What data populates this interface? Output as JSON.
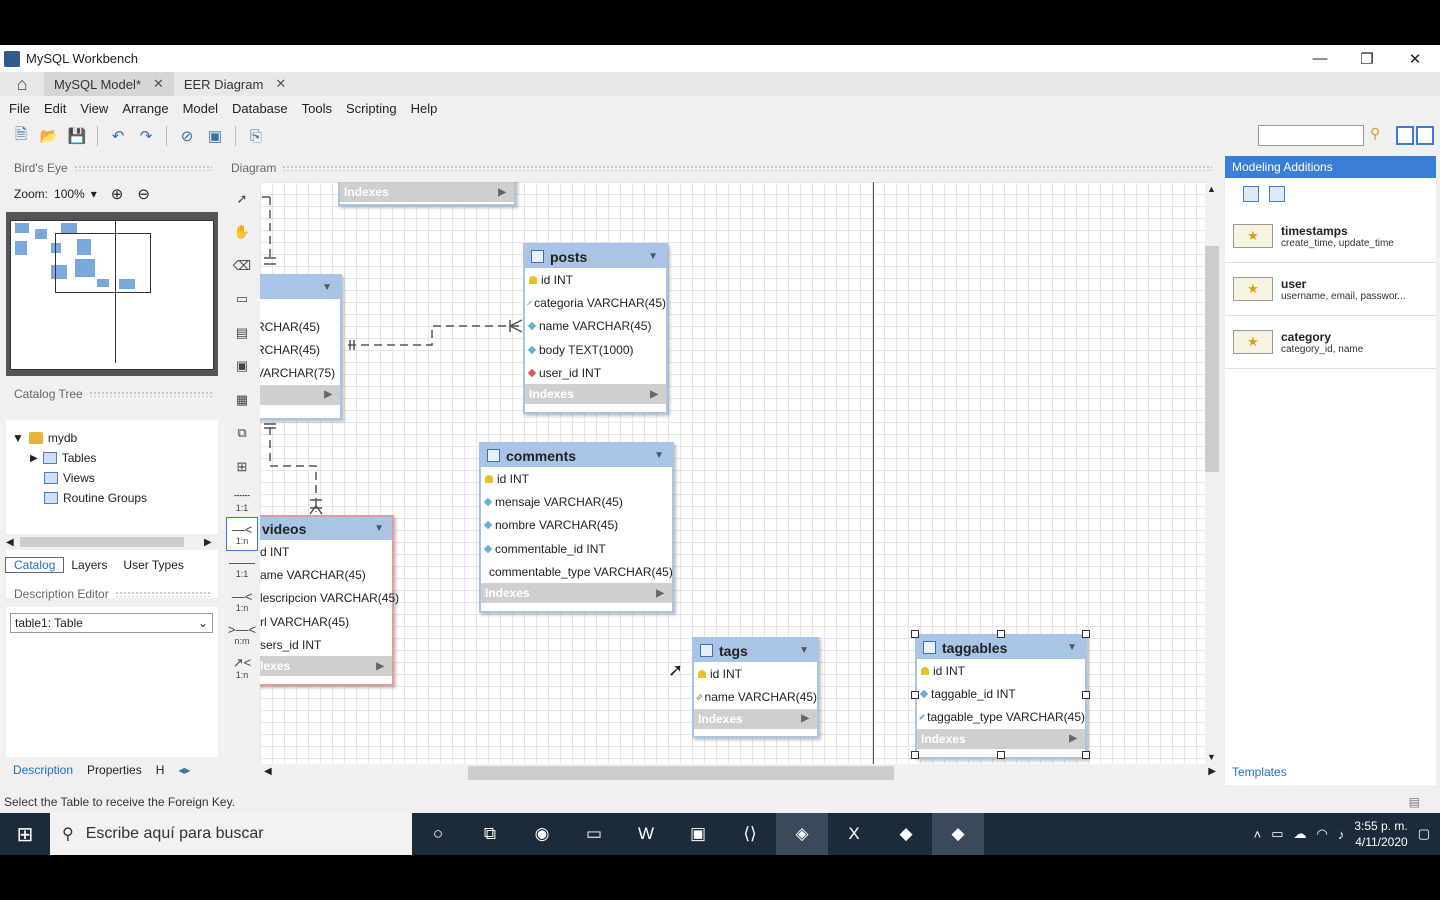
{
  "window": {
    "title": "MySQL Workbench"
  },
  "tabs": [
    {
      "label": "MySQL Model*"
    },
    {
      "label": "EER Diagram"
    }
  ],
  "menu": [
    "File",
    "Edit",
    "View",
    "Arrange",
    "Model",
    "Database",
    "Tools",
    "Scripting",
    "Help"
  ],
  "birdseye": {
    "header": "Bird's Eye",
    "zoom_label": "Zoom:",
    "zoom_value": "100%"
  },
  "catalog": {
    "header": "Catalog Tree",
    "db": "mydb",
    "items": [
      "Tables",
      "Views",
      "Routine Groups"
    ],
    "tabs": [
      "Catalog",
      "Layers",
      "User Types"
    ]
  },
  "desc": {
    "header": "Description Editor",
    "selected": "table1: Table",
    "tabs": [
      "Description",
      "Properties",
      "H"
    ]
  },
  "diagram": {
    "header": "Diagram"
  },
  "tools": [
    {
      "l": "1:1"
    },
    {
      "l": "1:n"
    },
    {
      "l": "1:1"
    },
    {
      "l": "1:n"
    },
    {
      "l": "n:m"
    },
    {
      "l": "1:n"
    }
  ],
  "entities": {
    "posts": {
      "name": "posts",
      "rows": [
        "id INT",
        "categoria VARCHAR(45)",
        "name VARCHAR(45)",
        "body TEXT(1000)",
        "user_id INT"
      ],
      "idx": "Indexes"
    },
    "comments": {
      "name": "comments",
      "rows": [
        "id INT",
        "mensaje VARCHAR(45)",
        "nombre VARCHAR(45)",
        "commentable_id INT",
        "commentable_type VARCHAR(45)"
      ],
      "idx": "Indexes"
    },
    "videos": {
      "name": "videos",
      "rows": [
        "d INT",
        "ame VARCHAR(45)",
        "lescripcion VARCHAR(45)",
        "rl VARCHAR(45)",
        "sers_id INT"
      ],
      "idx": "lexes"
    },
    "tags": {
      "name": "tags",
      "rows": [
        "id INT",
        "name VARCHAR(45)"
      ],
      "idx": "Indexes"
    },
    "taggables": {
      "name": "taggables",
      "rows": [
        "id INT",
        "taggable_id INT",
        "taggable_type VARCHAR(45)"
      ],
      "idx": "Indexes"
    },
    "left": {
      "rows": [
        "RCHAR(45)",
        "RCHAR(45)",
        "VARCHAR(75)"
      ]
    },
    "top": {
      "idx": "Indexes"
    }
  },
  "modeling": {
    "header": "Modeling Additions",
    "templates": [
      {
        "name": "timestamps",
        "desc": "create_time, update_time"
      },
      {
        "name": "user",
        "desc": "username, email, passwor..."
      },
      {
        "name": "category",
        "desc": "category_id, name"
      }
    ],
    "tab": "Templates"
  },
  "status": "Select the Table to receive the Foreign Key.",
  "taskbar": {
    "search": "Escribe aquí para buscar",
    "time": "3:55 p. m.",
    "date": "4/11/2020"
  }
}
